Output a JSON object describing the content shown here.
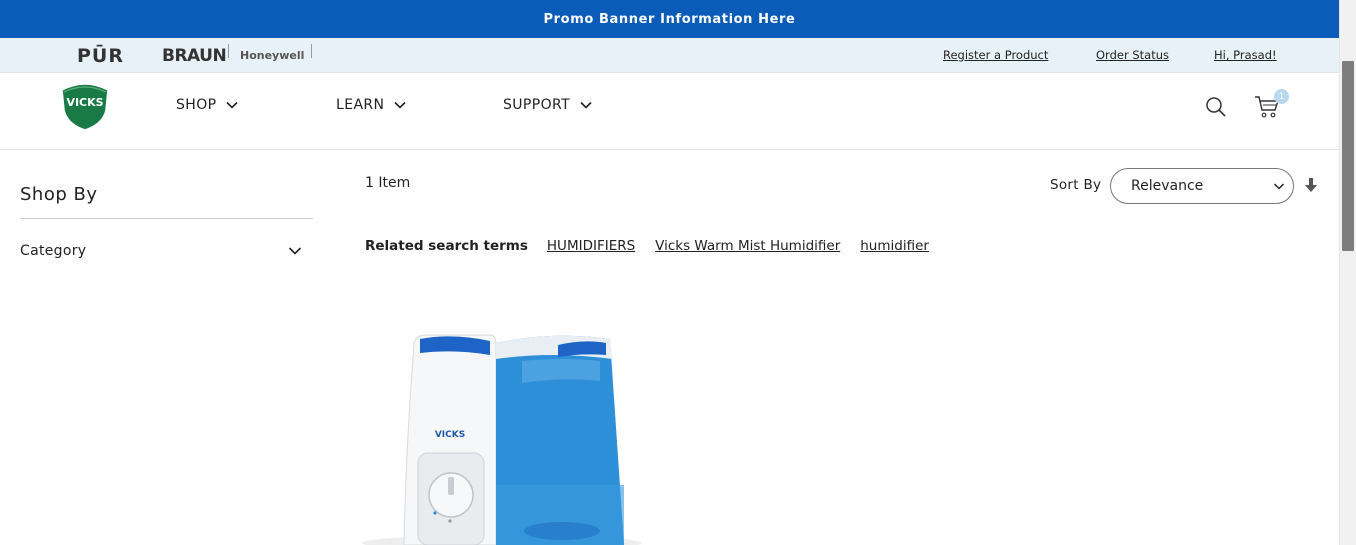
{
  "promo": {
    "text": "Promo Banner Information Here"
  },
  "brands": {
    "pur": "PŪR",
    "braun": "BRAUN",
    "honeywell": "Honeywell"
  },
  "utility": {
    "register": "Register a Product",
    "order_status": "Order Status",
    "account": "Hi, Prasad!"
  },
  "nav": {
    "logo": "VICKS",
    "items": [
      {
        "label": "SHOP"
      },
      {
        "label": "LEARN"
      },
      {
        "label": "SUPPORT"
      }
    ],
    "cart_count": "1"
  },
  "sidebar": {
    "title": "Shop By",
    "filters": [
      {
        "label": "Category"
      }
    ]
  },
  "results": {
    "count": "1 Item",
    "sort_label": "Sort By",
    "sort_value": "Relevance",
    "related_label": "Related search terms",
    "related_terms": [
      "HUMIDIFIERS",
      "Vicks Warm Mist Humidifier",
      "humidifier"
    ]
  },
  "product": {
    "brand_text": "VICKS"
  },
  "colors": {
    "promo": "#0a5cb8",
    "brandbar": "#e9f1f8",
    "vicks_green": "#1a7a45",
    "tank_blue": "#2d8fd8"
  }
}
